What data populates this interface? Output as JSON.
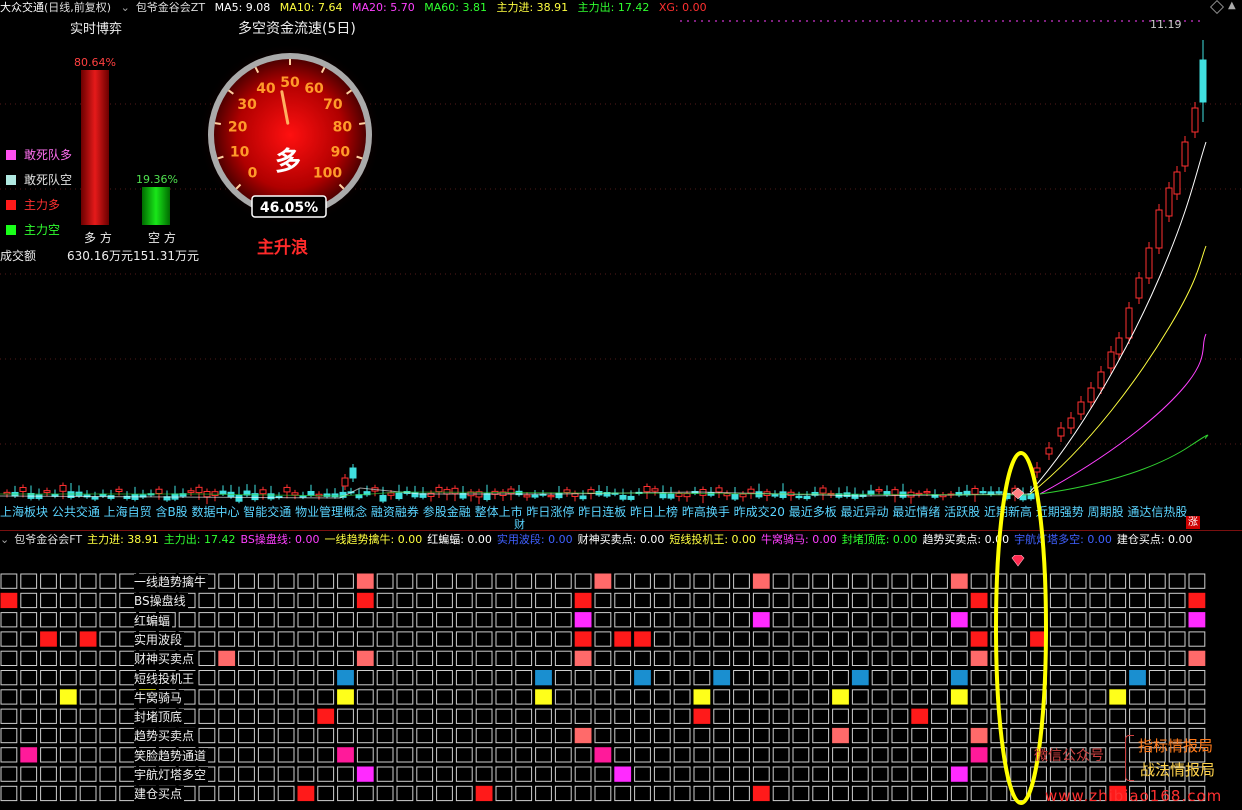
{
  "top_bar": {
    "stock_name": "大众交通",
    "period": "(日线,前复权)",
    "indicator": "包爷金谷会ZT",
    "ma5": "MA5: 9.08",
    "ma10": "MA10: 7.64",
    "ma20": "MA20: 5.70",
    "ma60": "MA60: 3.81",
    "main_in": "主力进: 38.91",
    "main_out": "主力出: 17.42",
    "xg": "XG: 0.00"
  },
  "price_high_label": "11.19",
  "realtime": {
    "title": "实时博弈",
    "bull_pct": "80.64%",
    "bear_pct": "19.36%",
    "bull_label": "多 方",
    "bear_label": "空 方",
    "volume_label": "成交额",
    "bull_amount": "630.16万元",
    "bear_amount": "151.31万元",
    "bull_value": 80.64,
    "bear_value": 19.36
  },
  "legend": [
    {
      "label": "敢死队多",
      "color": "#ff4ff0",
      "text_color": "#ff6ff0"
    },
    {
      "label": "敢死队空",
      "color": "#b0e8e0",
      "text_color": "#e0e0e0"
    },
    {
      "label": "主力多",
      "color": "#ff1a1a",
      "text_color": "#ff3030"
    },
    {
      "label": "主力空",
      "color": "#1aff1a",
      "text_color": "#30ff30"
    }
  ],
  "gauge": {
    "title": "多空资金流速(5日)",
    "ticks": [
      "0",
      "10",
      "20",
      "30",
      "40",
      "50",
      "60",
      "70",
      "80",
      "90",
      "100"
    ],
    "center_label": "多",
    "percent": "46.05%",
    "value": 46.05,
    "state": "主升浪"
  },
  "sectors": "上海板块 公共交通 上海自贸 含B股 数据中心 智能交通 物业管理概念 融资融券 参股金融 整体上市 昨日涨停 昨日连板 昨日上榜 昨高换手 昨成交20 最近多板 最近异动 最近情绪 活跃股 近期新高 近期强势 周期股 通达信热股",
  "sector_mark_fin": "财",
  "sector_mark_zhang": "涨",
  "lower_header": [
    {
      "text": "包爷金谷会FT",
      "color": "#dddddd"
    },
    {
      "text": "主力进: 38.91",
      "color": "#ffff40"
    },
    {
      "text": "主力出: 17.42",
      "color": "#30ff30"
    },
    {
      "text": "BS操盘线: 0.00",
      "color": "#ff40ff"
    },
    {
      "text": "一线趋势擒牛: 0.00",
      "color": "#ffff40"
    },
    {
      "text": "红蝙蝠: 0.00",
      "color": "#ffffff"
    },
    {
      "text": "实用波段: 0.00",
      "color": "#4060ff"
    },
    {
      "text": "财神买卖点: 0.00",
      "color": "#ffffff"
    },
    {
      "text": "短线投机王: 0.00",
      "color": "#ffff40"
    },
    {
      "text": "牛窝骑马: 0.00",
      "color": "#ff40ff"
    },
    {
      "text": "封堵顶底: 0.00",
      "color": "#30ff30"
    },
    {
      "text": "趋势买卖点: 0.00",
      "color": "#ffffff"
    },
    {
      "text": "宇航灯塔多空: 0.00",
      "color": "#4060ff"
    },
    {
      "text": "建仓买点: 0.00",
      "color": "#ffffff"
    }
  ],
  "grid_rows": [
    {
      "label": "一线趋势擒牛",
      "marks": [
        [
          18,
          "#ff6a6a"
        ],
        [
          30,
          "#ff6a6a"
        ],
        [
          38,
          "#ff6a6a"
        ],
        [
          48,
          "#ff6a6a"
        ],
        [
          66,
          "#ff6a6a"
        ],
        [
          70,
          "#ff6a6a"
        ]
      ]
    },
    {
      "label": "BS操盘线",
      "marks": [
        [
          0,
          "#ff1a1a"
        ],
        [
          18,
          "#ff1a1a"
        ],
        [
          29,
          "#ff1a1a"
        ],
        [
          49,
          "#ff1a1a"
        ],
        [
          60,
          "#ff1a1a"
        ],
        [
          67,
          "#ff1a1a"
        ]
      ]
    },
    {
      "label": "红蝙蝠",
      "marks": [
        [
          29,
          "#ff2aff"
        ],
        [
          38,
          "#ff2aff"
        ],
        [
          48,
          "#ff2aff"
        ],
        [
          60,
          "#ff2aff"
        ],
        [
          67,
          "#ff2aff"
        ]
      ]
    },
    {
      "label": "实用波段",
      "marks": [
        [
          2,
          "#ff1a1a"
        ],
        [
          4,
          "#ff1a1a"
        ],
        [
          29,
          "#ff1a1a"
        ],
        [
          31,
          "#ff1a1a"
        ],
        [
          32,
          "#ff1a1a"
        ],
        [
          49,
          "#ff1a1a"
        ],
        [
          52,
          "#ff1a1a"
        ],
        [
          67,
          "#ff1a1a"
        ]
      ]
    },
    {
      "label": "财神买卖点",
      "marks": [
        [
          11,
          "#ff6a6a"
        ],
        [
          18,
          "#ff6a6a"
        ],
        [
          29,
          "#ff6a6a"
        ],
        [
          49,
          "#ff6a6a"
        ],
        [
          60,
          "#ff6a6a"
        ],
        [
          67,
          "#ff6a6a"
        ],
        [
          68,
          "#ff6a6a"
        ]
      ]
    },
    {
      "label": "短线投机王",
      "marks": [
        [
          17,
          "#1a8fd0"
        ],
        [
          27,
          "#1a8fd0"
        ],
        [
          32,
          "#1a8fd0"
        ],
        [
          36,
          "#1a8fd0"
        ],
        [
          43,
          "#1a8fd0"
        ],
        [
          48,
          "#1a8fd0"
        ],
        [
          57,
          "#1a8fd0"
        ],
        [
          67,
          "#1a8fd0"
        ]
      ]
    },
    {
      "label": "牛窝骑马",
      "marks": [
        [
          3,
          "#ffff1a"
        ],
        [
          7,
          "#ffff1a"
        ],
        [
          17,
          "#ffff1a"
        ],
        [
          27,
          "#ffff1a"
        ],
        [
          35,
          "#ffff1a"
        ],
        [
          42,
          "#ffff1a"
        ],
        [
          48,
          "#ffff1a"
        ],
        [
          56,
          "#ffff1a"
        ],
        [
          67,
          "#ffff1a"
        ]
      ]
    },
    {
      "label": "封堵顶底",
      "marks": [
        [
          16,
          "#ff1a1a"
        ],
        [
          35,
          "#ff1a1a"
        ],
        [
          46,
          "#ff1a1a"
        ],
        [
          65,
          "#ff1a1a"
        ]
      ]
    },
    {
      "label": "趋势买卖点",
      "marks": [
        [
          29,
          "#ff6a6a"
        ],
        [
          42,
          "#ff6a6a"
        ],
        [
          49,
          "#ff6a6a"
        ],
        [
          66,
          "#ff6a6a"
        ]
      ]
    },
    {
      "label": "笑脸趋势通道",
      "marks": [
        [
          1,
          "#ff1a9a"
        ],
        [
          17,
          "#ff1a9a"
        ],
        [
          30,
          "#ff1a9a"
        ],
        [
          49,
          "#ff1a9a"
        ],
        [
          67,
          "#ff1a9a"
        ]
      ]
    },
    {
      "label": "宇航灯塔多空",
      "marks": [
        [
          18,
          "#ff2aff"
        ],
        [
          31,
          "#ff2aff"
        ],
        [
          48,
          "#ff2aff"
        ]
      ]
    },
    {
      "label": "建仓买点",
      "marks": [
        [
          15,
          "#ff1a1a"
        ],
        [
          24,
          "#ff1a1a"
        ],
        [
          38,
          "#ff1a1a"
        ],
        [
          56,
          "#ff1a1a"
        ]
      ]
    }
  ],
  "watermark": {
    "line1": "指标情报局",
    "line2": "战法情报局",
    "wechat": "微信公众号",
    "site": "www.zhibiao168.com"
  }
}
